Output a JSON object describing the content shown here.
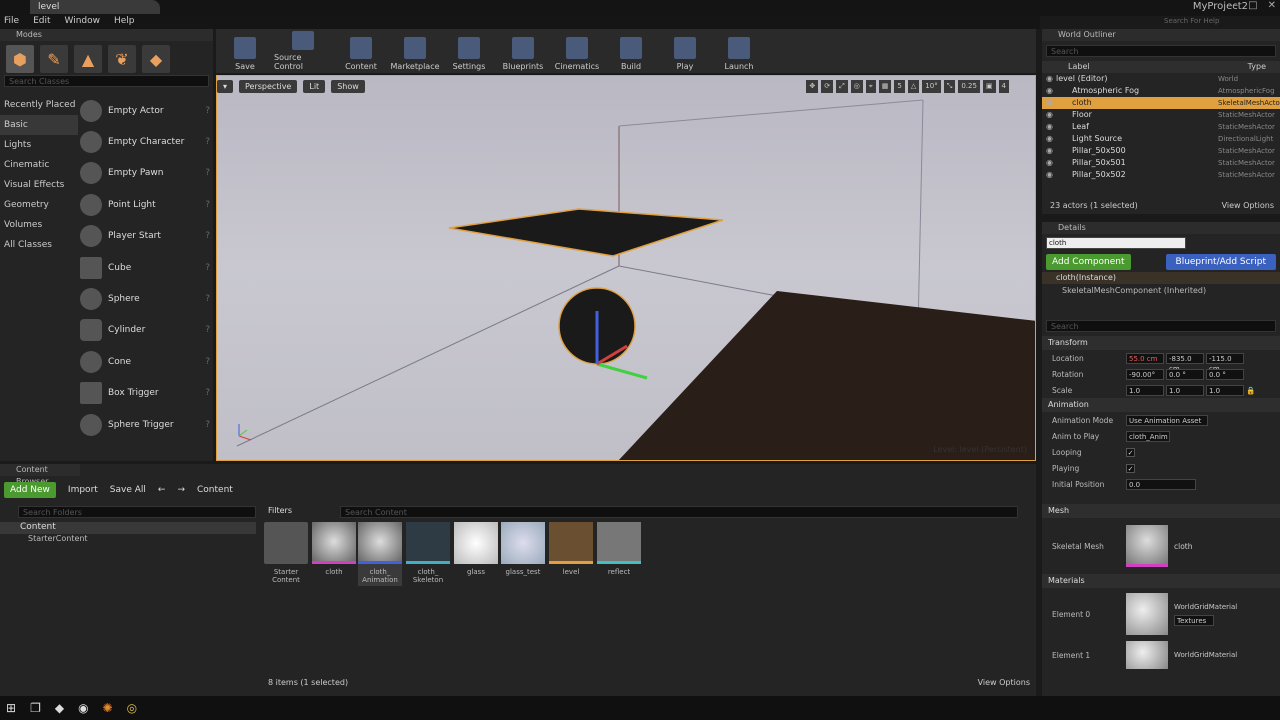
{
  "window": {
    "tab_title": "level",
    "project": "MyProject2",
    "search_help": "Search For Help"
  },
  "menu": [
    "File",
    "Edit",
    "Window",
    "Help"
  ],
  "modes": {
    "title": "Modes",
    "search_placeholder": "Search Classes",
    "categories": [
      "Recently Placed",
      "Basic",
      "Lights",
      "Cinematic",
      "Visual Effects",
      "Geometry",
      "Volumes",
      "All Classes"
    ],
    "items": [
      "Empty Actor",
      "Empty Character",
      "Empty Pawn",
      "Point Light",
      "Player Start",
      "Cube",
      "Sphere",
      "Cylinder",
      "Cone",
      "Box Trigger",
      "Sphere Trigger"
    ]
  },
  "toolbar": [
    "Save",
    "Source Control",
    "Content",
    "Marketplace",
    "Settings",
    "Blueprints",
    "Cinematics",
    "Build",
    "Play",
    "Launch"
  ],
  "viewport": {
    "perspective": "Perspective",
    "lit": "Lit",
    "show": "Show",
    "grid_angle": "10°",
    "grid_5": "5",
    "scale_snap": "0.25",
    "cam_speed": "4",
    "level_label": "Level:",
    "level_name": "level (Persistent)"
  },
  "outliner": {
    "title": "World Outliner",
    "search_placeholder": "Search",
    "col_label": "Label",
    "col_type": "Type",
    "rows": [
      {
        "name": "level (Editor)",
        "type": "World"
      },
      {
        "name": "Atmospheric Fog",
        "type": "AtmosphericFog"
      },
      {
        "name": "cloth",
        "type": "SkeletalMeshActor"
      },
      {
        "name": "Floor",
        "type": "StaticMeshActor"
      },
      {
        "name": "Leaf",
        "type": "StaticMeshActor"
      },
      {
        "name": "Light Source",
        "type": "DirectionalLight"
      },
      {
        "name": "Pillar_50x500",
        "type": "StaticMeshActor"
      },
      {
        "name": "Pillar_50x501",
        "type": "StaticMeshActor"
      },
      {
        "name": "Pillar_50x502",
        "type": "StaticMeshActor"
      }
    ],
    "count": "23 actors (1 selected)",
    "view_options": "View Options"
  },
  "details": {
    "title": "Details",
    "name_value": "cloth",
    "add_component": "Add Component",
    "blueprint": "Blueprint/Add Script",
    "instance": "cloth(Instance)",
    "component": "SkeletalMeshComponent (Inherited)",
    "search_placeholder": "Search",
    "transform": "Transform",
    "location_label": "Location",
    "location": [
      "55.0 cm",
      "-835.0 cm",
      "-115.0 cm"
    ],
    "rotation_label": "Rotation",
    "rotation": [
      "-90.00°",
      "0.0 °",
      "0.0 °"
    ],
    "scale_label": "Scale",
    "scale": [
      "1.0",
      "1.0",
      "1.0"
    ],
    "animation": "Animation",
    "anim_mode_label": "Animation Mode",
    "anim_mode": "Use Animation Asset",
    "anim_play_label": "Anim to Play",
    "anim_play": "cloth_Anim",
    "looping_label": "Looping",
    "playing_label": "Playing",
    "initpos_label": "Initial Position",
    "initpos": "0.0",
    "mesh": "Mesh",
    "skel_label": "Skeletal Mesh",
    "skel_value": "cloth",
    "materials": "Materials",
    "el0_label": "Element 0",
    "el0_value": "WorldGridMaterial",
    "textures": "Textures",
    "el1_label": "Element 1",
    "el1_value": "WorldGridMaterial"
  },
  "content_browser": {
    "title": "Content Browser",
    "add_new": "Add New",
    "import": "Import",
    "save_all": "Save All",
    "path": "Content",
    "folder_search": "Search Folders",
    "filters": "Filters",
    "content_search": "Search Content",
    "tree_root": "Content",
    "tree_child": "StarterContent",
    "assets": [
      {
        "line1": "Starter",
        "line2": "Content"
      },
      {
        "line1": "cloth",
        "line2": ""
      },
      {
        "line1": "cloth_",
        "line2": "Animation"
      },
      {
        "line1": "cloth_",
        "line2": "Skeleton"
      },
      {
        "line1": "glass",
        "line2": ""
      },
      {
        "line1": "glass_test",
        "line2": ""
      },
      {
        "line1": "level",
        "line2": ""
      },
      {
        "line1": "reflect",
        "line2": ""
      }
    ],
    "status": "8 items (1 selected)",
    "view_options": "View Options"
  },
  "colors": {
    "selection": "#e0a040",
    "add_green": "#4a9a30",
    "blueprint_blue": "#3a60c0"
  }
}
